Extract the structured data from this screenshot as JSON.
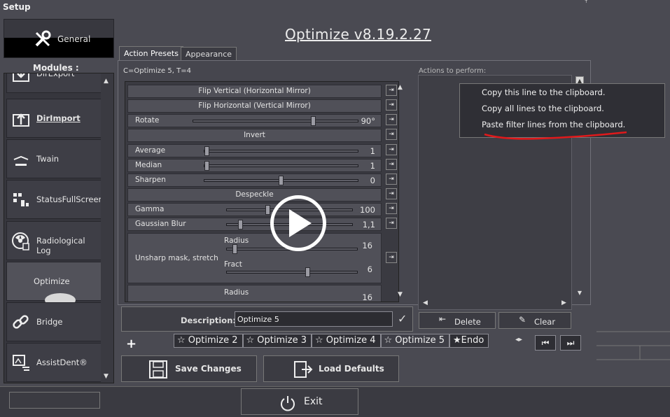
{
  "window": {
    "title": "Setup",
    "pin_glyph": "ᵀ"
  },
  "app": {
    "title": "Optimize v8.19.2.27"
  },
  "general": {
    "label": "General",
    "icon": "tools-icon"
  },
  "modules_label": "Modules :",
  "modules": [
    {
      "label": "DirExport",
      "icon": "download-icon"
    },
    {
      "label": "DirImport",
      "icon": "upload-icon"
    },
    {
      "label": "Twain",
      "icon": "scanner-icon"
    },
    {
      "label": "StatusFullScreen",
      "icon": "grid-icon"
    },
    {
      "label": "Radiological Log",
      "icon": "radiation-icon"
    },
    {
      "label": "Optimize",
      "icon": "optimize-icon"
    },
    {
      "label": "Bridge",
      "icon": "link-icon"
    },
    {
      "label": "AssistDent®",
      "icon": "assist-icon"
    }
  ],
  "tabs": {
    "action_presets": "Action Presets",
    "appearance": "Appearance"
  },
  "formula": "C=Optimize 5, T=4",
  "filters": {
    "flip_vertical": "Flip Vertical (Horizontal Mirror)",
    "flip_horizontal": "Flip Horizontal (Vertical Mirror)",
    "rotate": {
      "label": "Rotate",
      "value": "90°"
    },
    "invert": "Invert",
    "average": {
      "label": "Average",
      "value": "1"
    },
    "median": {
      "label": "Median",
      "value": "1"
    },
    "sharpen": {
      "label": "Sharpen",
      "value": "0"
    },
    "despeckle": "Despeckle",
    "gamma": {
      "label": "Gamma",
      "value": "100"
    },
    "gaussian": {
      "label": "Gaussian Blur",
      "value": "1,1"
    },
    "unsharp": {
      "label": "Unsharp mask, stretch",
      "radius_label": "Radius",
      "radius_value": "16",
      "fract_label": "Fract",
      "fract_value": "6"
    },
    "next": {
      "radius_label": "Radius",
      "radius_value": "16"
    },
    "arrow_glyph": "⇥"
  },
  "actions": {
    "label": "Actions to perform:"
  },
  "context_menu": [
    "Copy this line to the clipboard.",
    "Copy all lines to the clipboard.",
    "Paste filter lines from the clipboard."
  ],
  "buttons": {
    "delete": "Delete",
    "clear": "Clear",
    "save": "Save Changes",
    "load": "Load Defaults",
    "exit": "Exit"
  },
  "description": {
    "label": "Description:",
    "value": "Optimize 5"
  },
  "presets": [
    "Optimize 2",
    "Optimize 3",
    "Optimize 4",
    "Optimize 5",
    "Endo"
  ],
  "plus_glyph": "+",
  "nav": {
    "arrows": "◂▸",
    "first": "⏮",
    "last": "⏭"
  },
  "colors": {
    "accent_red": "#e0191b",
    "background": "#4a4a52"
  }
}
